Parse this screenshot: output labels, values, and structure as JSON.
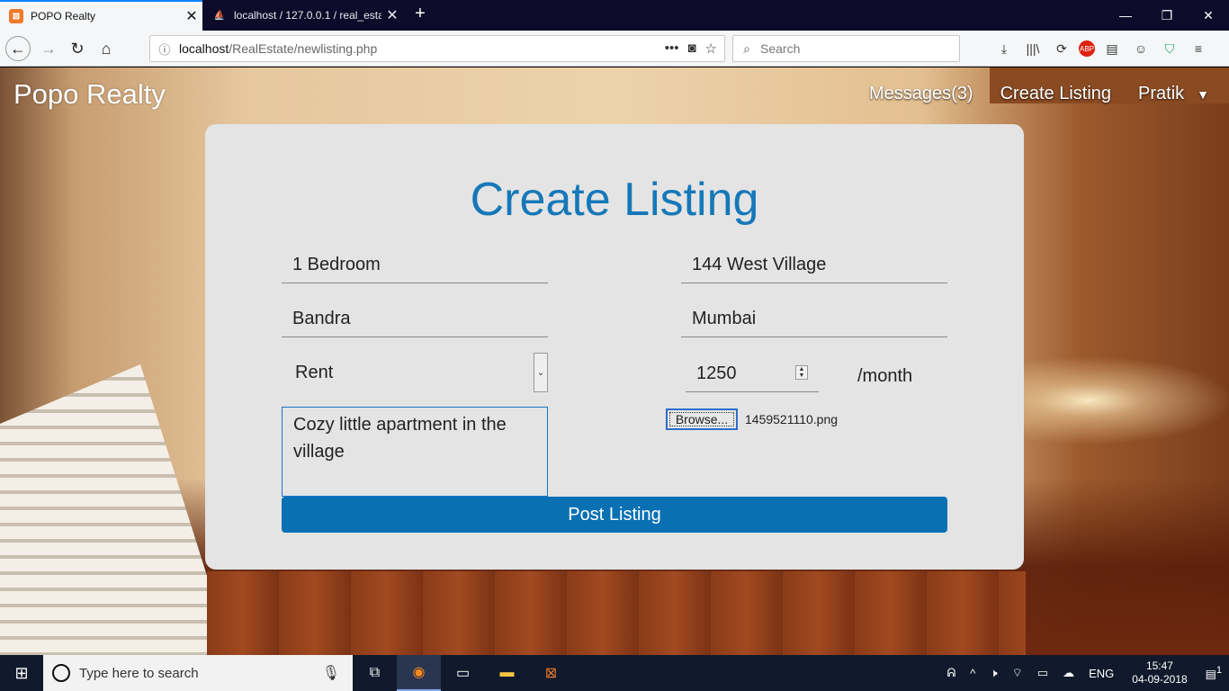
{
  "browser": {
    "tabs": [
      {
        "title": "POPO Realty",
        "active": true
      },
      {
        "title": "localhost / 127.0.0.1 / real_estat",
        "active": false
      }
    ],
    "new_tab": "+",
    "url": {
      "host": "localhost",
      "path": "/RealEstate/newlisting.php"
    },
    "search_placeholder": "Search"
  },
  "site": {
    "brand": "Popo Realty",
    "nav": {
      "messages": "Messages(3)",
      "create_listing": "Create Listing",
      "user": "Pratik"
    }
  },
  "form": {
    "heading": "Create Listing",
    "title_value": "1 Bedroom",
    "address_value": "144 West Village",
    "locality_value": "Bandra",
    "city_value": "Mumbai",
    "type_selected": "Rent",
    "price_value": "1250",
    "price_unit": "/month",
    "description_value": "Cozy little apartment in the village",
    "browse_label": "Browse...",
    "file_name": "1459521110.png",
    "submit_label": "Post Listing"
  },
  "taskbar": {
    "search_placeholder": "Type here to search",
    "language": "ENG",
    "time": "15:47",
    "date": "04-09-2018",
    "notifications": "1"
  },
  "colors": {
    "accent": "#1578b8",
    "button": "#0a70b4",
    "card": "#e4e4e4"
  }
}
